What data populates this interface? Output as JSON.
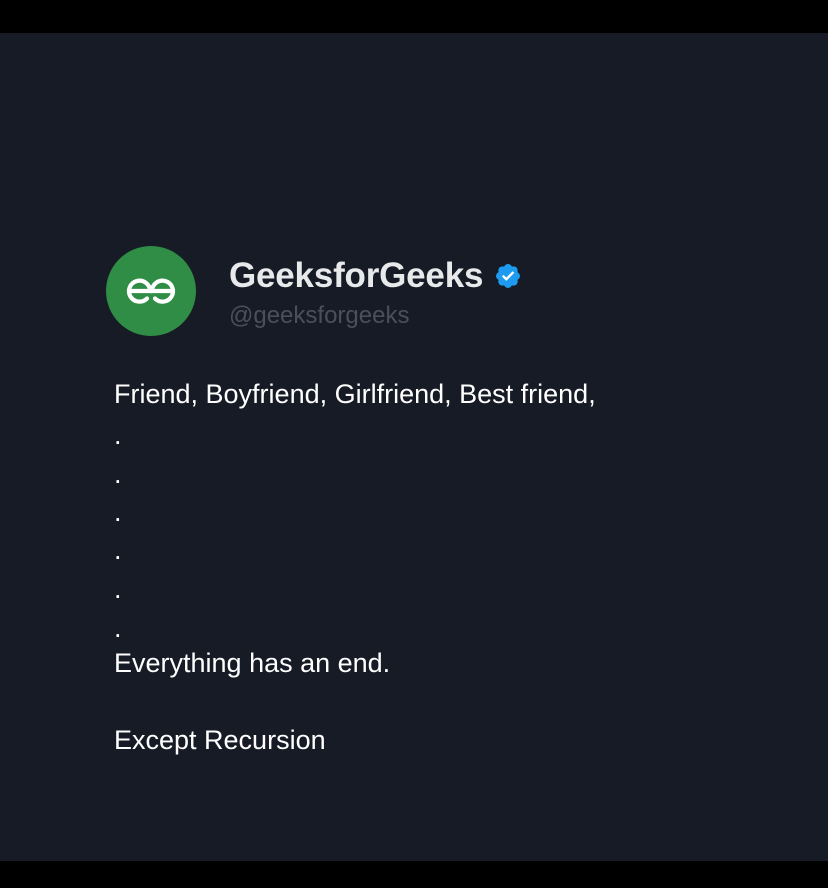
{
  "colors": {
    "background": "#171b25",
    "letterbox": "#000000",
    "avatar_bg": "#2f8d46",
    "name_text": "#e7e9ea",
    "handle_text": "#4a505a",
    "body_text": "#ffffff",
    "verified_badge": "#1d9bf0"
  },
  "author": {
    "avatar_icon": "gfg-logo-icon",
    "display_name": "GeeksforGeeks",
    "verified_icon": "verified-badge-icon",
    "handle": "@geeksforgeeks"
  },
  "tweet": {
    "line1": "Friend, Boyfriend, Girlfriend, Best friend,",
    "dots": [
      ".",
      ".",
      ".",
      ".",
      ".",
      "."
    ],
    "line2": "Everything has an end.",
    "line3": "Except Recursion"
  }
}
